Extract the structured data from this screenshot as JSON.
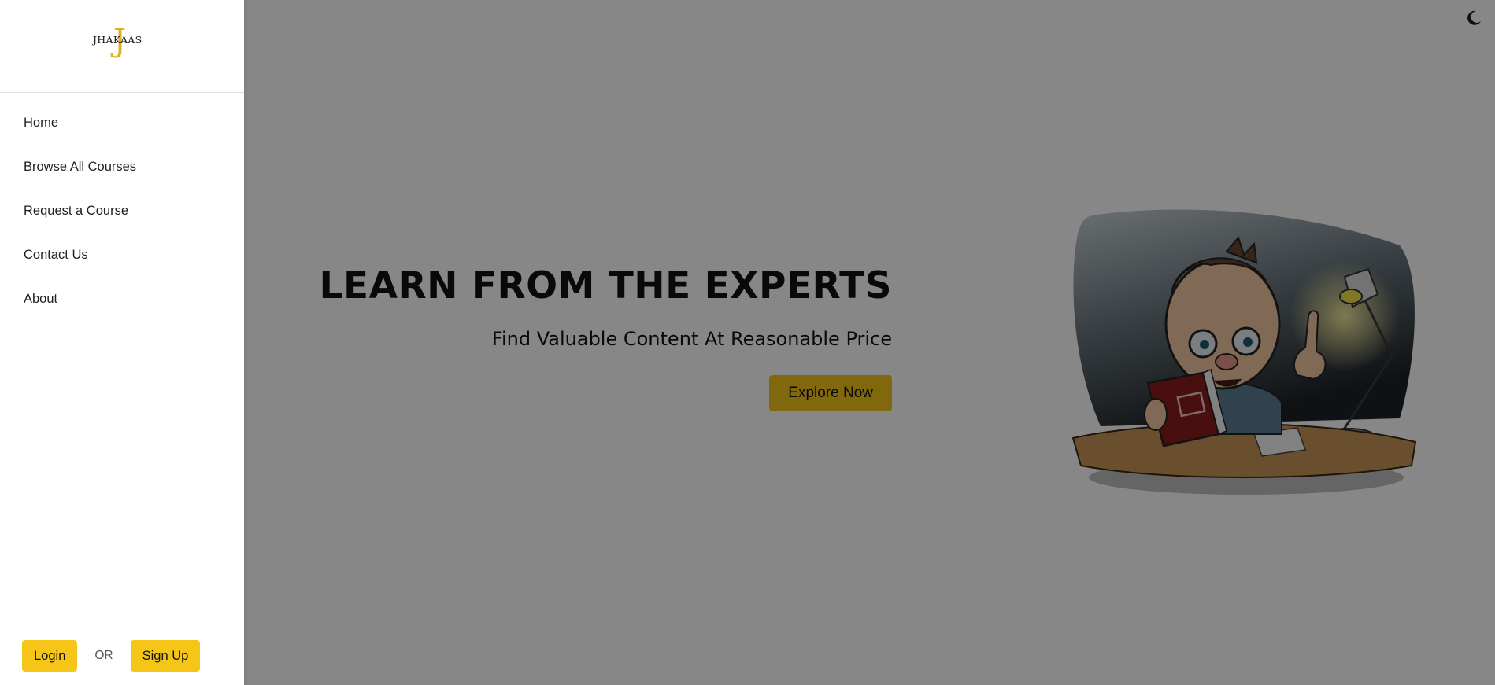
{
  "sidebar": {
    "logo_text": "JHAKAAS",
    "logo_letter": "J",
    "nav_items": [
      {
        "label": "Home"
      },
      {
        "label": "Browse All Courses"
      },
      {
        "label": "Request a Course"
      },
      {
        "label": "Contact Us"
      },
      {
        "label": "About"
      }
    ],
    "login_label": "Login",
    "or_label": "OR",
    "signup_label": "Sign Up"
  },
  "hero": {
    "title": "LEARN FROM THE EXPERTS",
    "subtitle": "Find Valuable Content At Reasonable Price",
    "cta_label": "Explore Now",
    "illustration": "professor-reading-book-with-lamp"
  },
  "header": {
    "theme_toggle_icon": "moon-icon"
  },
  "colors": {
    "accent": "#f5c518",
    "logo_gold": "#e0b020",
    "text_dark": "#111111",
    "overlay": "rgba(0,0,0,0.47)"
  }
}
